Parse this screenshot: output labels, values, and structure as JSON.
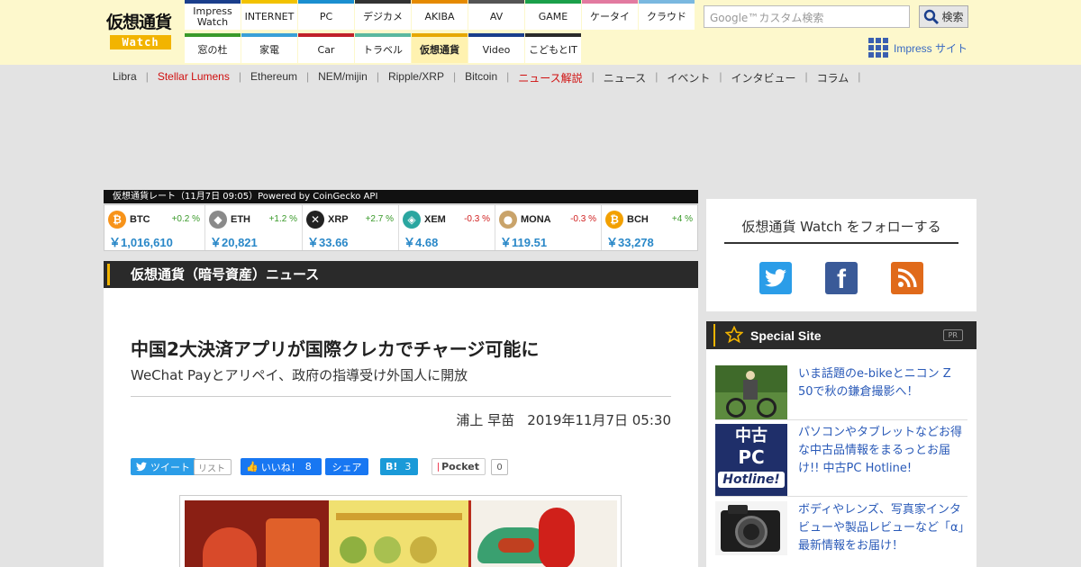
{
  "header": {
    "logo_text": "仮想通貨",
    "logo_sub": "Watch",
    "nav_top": [
      {
        "label": "Impress Watch",
        "color": "#1a3e8c"
      },
      {
        "label": "INTERNET",
        "color": "#f2c200"
      },
      {
        "label": "PC",
        "color": "#1a8fd0"
      },
      {
        "label": "デジカメ",
        "color": "#333333"
      },
      {
        "label": "AKIBA",
        "color": "#e58a00"
      },
      {
        "label": "AV",
        "color": "#555555"
      },
      {
        "label": "GAME",
        "color": "#1aa04a"
      },
      {
        "label": "ケータイ",
        "color": "#e27aa0"
      },
      {
        "label": "クラウド",
        "color": "#7ab8e0"
      }
    ],
    "nav_bottom": [
      {
        "label": "窓の杜",
        "color": "#3a9a2a"
      },
      {
        "label": "家電",
        "color": "#3aa0d8"
      },
      {
        "label": "Car",
        "color": "#c0202a"
      },
      {
        "label": "トラベル",
        "color": "#5ab8a0"
      },
      {
        "label": "仮想通貨",
        "color": "#e6a800",
        "active": true
      },
      {
        "label": "Video",
        "color": "#1a3e8c"
      },
      {
        "label": "こどもとIT",
        "color": "#2a2a2a"
      }
    ],
    "search_placeholder": "Google™カスタム検索",
    "search_button": "検索",
    "impress_site": "Impress サイト"
  },
  "subnav": [
    {
      "label": "Libra",
      "red": false
    },
    {
      "label": "Stellar Lumens",
      "red": true
    },
    {
      "label": "Ethereum",
      "red": false
    },
    {
      "label": "NEM/mijin",
      "red": false
    },
    {
      "label": "Ripple/XRP",
      "red": false
    },
    {
      "label": "Bitcoin",
      "red": false
    },
    {
      "label": "ニュース解説",
      "red": true
    },
    {
      "label": "ニュース",
      "red": false
    },
    {
      "label": "イベント",
      "red": false
    },
    {
      "label": "インタビュー",
      "red": false
    },
    {
      "label": "コラム",
      "red": false
    }
  ],
  "rates": {
    "title": "仮想通貨レート（11月7日 09:05）Powered by CoinGecko API",
    "coins": [
      {
        "symbol": "BTC",
        "change": "+0.2 %",
        "direction": "up",
        "price": "￥1,016,610",
        "icon": "bitcoin-icon",
        "glyph": "₿",
        "color": "#f7931a"
      },
      {
        "symbol": "ETH",
        "change": "+1.2 %",
        "direction": "up",
        "price": "￥20,821",
        "icon": "ethereum-icon",
        "glyph": "◆",
        "color": "#8a8a8a"
      },
      {
        "symbol": "XRP",
        "change": "+2.7 %",
        "direction": "up",
        "price": "￥33.66",
        "icon": "ripple-icon",
        "glyph": "✕",
        "color": "#222222"
      },
      {
        "symbol": "XEM",
        "change": "-0.3 %",
        "direction": "down",
        "price": "￥4.68",
        "icon": "nem-icon",
        "glyph": "◈",
        "color": "#2aa6a0"
      },
      {
        "symbol": "MONA",
        "change": "-0.3 %",
        "direction": "down",
        "price": "￥119.51",
        "icon": "monacoin-icon",
        "glyph": "●",
        "color": "#c9a36a"
      },
      {
        "symbol": "BCH",
        "change": "+4 %",
        "direction": "up",
        "price": "￥33,278",
        "icon": "bitcoin-cash-icon",
        "glyph": "₿",
        "color": "#f2a000"
      }
    ]
  },
  "main": {
    "section_title": "仮想通貨（暗号資産）ニュース",
    "article_title": "中国2大決済アプリが国際クレカでチャージ可能に",
    "article_subtitle": "WeChat Payとアリペイ、政府の指導受け外国人に開放",
    "author": "浦上 早苗",
    "date": "2019年11月7日 05:30",
    "share": {
      "tweet": "ツイート",
      "list": "リスト",
      "like": "いいね！",
      "like_count": "8",
      "fb_share": "シェア",
      "hatena_count": "3",
      "pocket": "Pocket",
      "pocket_count": "0"
    }
  },
  "sidebar": {
    "follow_title": "仮想通貨 Watch をフォローする",
    "special_title": "Special Site",
    "pr": "PR",
    "items": [
      {
        "text": "いま話題のe-bikeとニコン Z 50で秋の鎌倉撮影へ！"
      },
      {
        "text": "パソコンやタブレットなどお得な中古品情報をまるっとお届け!! 中古PC Hotline!",
        "thumb_line1": "中古",
        "thumb_line2": "PC",
        "thumb_line3": "Hotline!"
      },
      {
        "text": "ボディやレンズ、写真家インタビューや製品レビューなど「α」最新情報をお届け！"
      }
    ]
  }
}
